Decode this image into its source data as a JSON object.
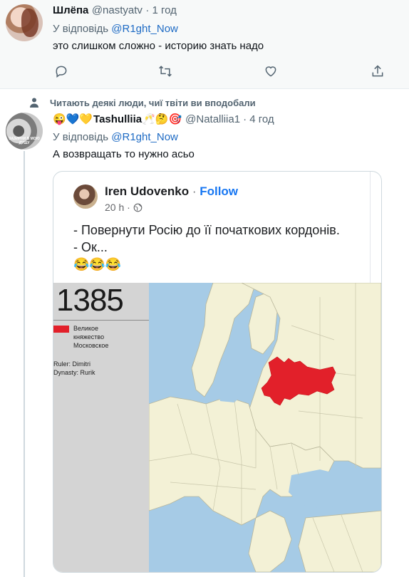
{
  "tweet1": {
    "name": "Шлёпа",
    "handle": "@nastyatv",
    "time": "· 1 год",
    "reply_prefix": "У відповідь ",
    "reply_to": "@R1ght_Now",
    "text": "это слишком сложно - историю знать надо",
    "icons": [
      "reply-icon",
      "retweet-icon",
      "like-icon",
      "share-icon"
    ]
  },
  "context": {
    "text": "Читають деякі люди, чиї твіти ви вподобали",
    "icon": "person-icon"
  },
  "tweet2": {
    "emojis_before": "😜💙💛",
    "name": "Tashulliia",
    "emojis_after": "🥂🤔🎯",
    "handle": "@Natalliia1",
    "time": "· 4 год",
    "reply_prefix": "У відповідь ",
    "reply_to": "@R1ght_Now",
    "text": "А возвращать то нужно асьо",
    "avatar_caption": "ЗАЗИРНИ В МОЮ ДУШУ"
  },
  "embed": {
    "author": "Iren Udovenko",
    "separator": " · ",
    "follow": "Follow",
    "meta": "20 h ·",
    "line1": "- Повернути Росію до її початкових кордонів.",
    "line2": "- Ок...",
    "emoji": "😂😂😂",
    "map": {
      "year": "1385",
      "legend_line1": "Великое",
      "legend_line2": "княжество",
      "legend_line3": "Московское",
      "ruler_label": "Ruler: Dimitri",
      "dynasty_label": "Dynasty: Rurik",
      "colors": {
        "sea": "#a6cbe6",
        "land": "#f3f1d6",
        "border": "#b8b69a",
        "highlight": "#e2202a",
        "panel": "#d4d4d4"
      }
    }
  }
}
